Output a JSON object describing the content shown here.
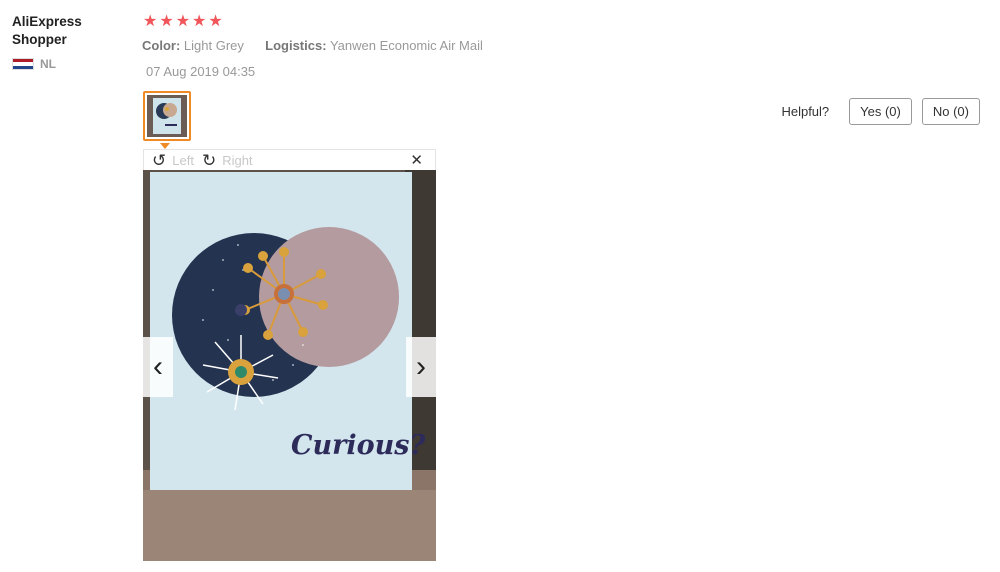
{
  "reviewer": {
    "name": "AliExpress Shopper",
    "country_code": "NL"
  },
  "rating": {
    "stars": 5,
    "star_color": "#f0565a"
  },
  "attributes": {
    "color_label": "Color:",
    "color_value": "Light Grey",
    "logistics_label": "Logistics:",
    "logistics_value": "Yanwen Economic Air Mail"
  },
  "date": "07 Aug 2019 04:35",
  "helpful": {
    "label": "Helpful?",
    "yes": "Yes (0)",
    "no": "No (0)"
  },
  "viewer": {
    "left_label": "Left",
    "right_label": "Right",
    "photo_text": "Curious?"
  },
  "colors": {
    "accent": "#f08a24"
  }
}
